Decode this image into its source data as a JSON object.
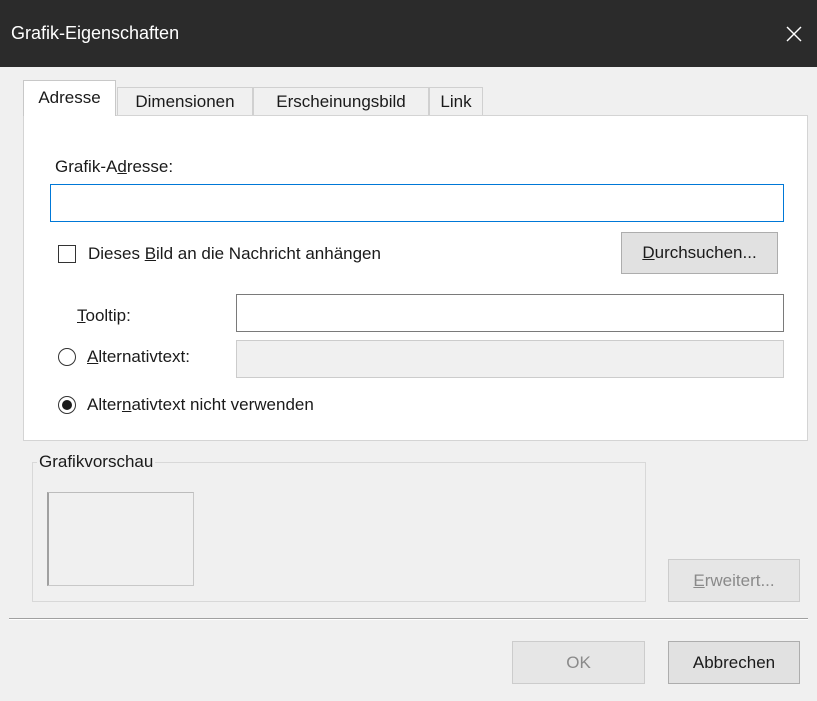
{
  "window": {
    "title": "Grafik-Eigenschaften",
    "close_glyph": "✕"
  },
  "tabs": [
    {
      "label": "Adresse",
      "active": true
    },
    {
      "label": "Dimensionen",
      "active": false
    },
    {
      "label": "Erscheinungsbild",
      "active": false
    },
    {
      "label": "Link",
      "active": false
    }
  ],
  "address_tab": {
    "image_address_label": {
      "before": "Grafik-A",
      "mnemonic": "d",
      "after": "resse:"
    },
    "image_address_value": "",
    "attach_checkbox": {
      "before": "Dieses ",
      "mnemonic": "B",
      "after": "ild an die Nachricht anhängen",
      "checked": false
    },
    "browse_button": {
      "mnemonic": "D",
      "after": "urchsuchen..."
    },
    "tooltip_label": {
      "mnemonic": "T",
      "after": "ooltip:"
    },
    "tooltip_value": "",
    "alt_text_radio": {
      "mnemonic": "A",
      "after": "lternativtext:",
      "selected": false
    },
    "alt_text_value": "",
    "no_alt_text_radio": {
      "before": "Alter",
      "mnemonic": "n",
      "after": "ativtext nicht verwenden",
      "selected": true
    }
  },
  "preview_group": {
    "label": "Grafikvorschau"
  },
  "advanced_button": {
    "mnemonic": "E",
    "after": "rweitert...",
    "enabled": false
  },
  "footer": {
    "ok_label": "OK",
    "ok_enabled": false,
    "cancel_label": "Abbrechen"
  },
  "colors": {
    "titlebar": "#2b2b2b",
    "focus_border": "#0078d7",
    "dialog_bg": "#f0f0f0"
  }
}
